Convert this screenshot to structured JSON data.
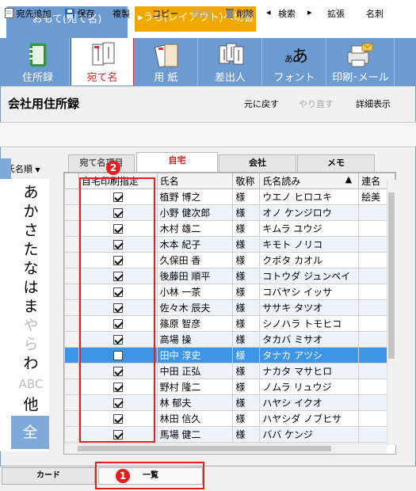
{
  "top_tabs": {
    "front": "おもて(宛て名)",
    "back": "▸うら(レイアウト)へ切替"
  },
  "ribbon": [
    {
      "label": "住所録",
      "icon": "address-book-icon",
      "active": false
    },
    {
      "label": "宛て名",
      "icon": "addressee-icon",
      "active": true
    },
    {
      "label": "用 紙",
      "icon": "paper-icon",
      "active": false
    },
    {
      "label": "差出人",
      "icon": "sender-icon",
      "active": false
    },
    {
      "label": "フォント",
      "icon": "font-icon",
      "active": false
    },
    {
      "label": "印刷･メール",
      "icon": "printer-mail-icon",
      "active": false
    }
  ],
  "window": {
    "title": "会社用住所録",
    "undo": "元に戻す",
    "redo": "やり直す",
    "detail": "詳細表示"
  },
  "toolbar": {
    "add": "宛先追加",
    "save": "保存",
    "duplicate": "複製",
    "copy": "コピー",
    "paste": "貼付",
    "delete": "削除",
    "search": "検索",
    "expand": "拡張",
    "card": "名刺"
  },
  "sort_label": "氏名順",
  "index": [
    "あ",
    "か",
    "さ",
    "た",
    "な",
    "は",
    "ま",
    "や",
    "ら",
    "わ",
    "ABC",
    "他",
    "全"
  ],
  "inner_tabs": {
    "addr_name": "宛て名項目",
    "home": "自宅",
    "company": "会社",
    "memo": "メモ"
  },
  "grid": {
    "headers": [
      "自宅印刷指定",
      "氏名",
      "敬称",
      "氏名読み",
      "連名"
    ],
    "sort_indicator": "▲",
    "rows": [
      {
        "checked": true,
        "name": "植野 博之",
        "honorific": "様",
        "reading": "ウエノ ヒロユキ",
        "joint": "絵美"
      },
      {
        "checked": true,
        "name": "小野 健次郎",
        "honorific": "様",
        "reading": "オノ ケンジロウ",
        "joint": ""
      },
      {
        "checked": true,
        "name": "木村 雄二",
        "honorific": "様",
        "reading": "キムラ ユウジ",
        "joint": ""
      },
      {
        "checked": true,
        "name": "木本 紀子",
        "honorific": "様",
        "reading": "キモト ノリコ",
        "joint": ""
      },
      {
        "checked": true,
        "name": "久保田 香",
        "honorific": "様",
        "reading": "クボタ カオル",
        "joint": ""
      },
      {
        "checked": true,
        "name": "後藤田 順平",
        "honorific": "様",
        "reading": "コトウダ ジュンペイ",
        "joint": ""
      },
      {
        "checked": true,
        "name": "小林 一茶",
        "honorific": "様",
        "reading": "コバヤシ イッサ",
        "joint": ""
      },
      {
        "checked": true,
        "name": "佐々木 辰夫",
        "honorific": "様",
        "reading": "ササキ タツオ",
        "joint": ""
      },
      {
        "checked": true,
        "name": "篠原 智彦",
        "honorific": "様",
        "reading": "シノハラ トモヒコ",
        "joint": ""
      },
      {
        "checked": true,
        "name": "高場 操",
        "honorific": "様",
        "reading": "タカバ ミサオ",
        "joint": ""
      },
      {
        "checked": false,
        "name": "田中 淳史",
        "honorific": "様",
        "reading": "タナカ アツシ",
        "joint": "",
        "selected": true
      },
      {
        "checked": true,
        "name": "中田 正弘",
        "honorific": "様",
        "reading": "ナカタ マサヒロ",
        "joint": ""
      },
      {
        "checked": true,
        "name": "野村 隆二",
        "honorific": "様",
        "reading": "ノムラ リュウジ",
        "joint": ""
      },
      {
        "checked": true,
        "name": "林 郁夫",
        "honorific": "様",
        "reading": "ハヤシ イクオ",
        "joint": ""
      },
      {
        "checked": true,
        "name": "林田 信久",
        "honorific": "様",
        "reading": "ハヤシダ ノブヒサ",
        "joint": ""
      },
      {
        "checked": true,
        "name": "馬場 健二",
        "honorific": "様",
        "reading": "ババ ケンジ",
        "joint": ""
      }
    ]
  },
  "annotations": {
    "badge1": "1",
    "badge2": "2"
  },
  "bottom_tabs": {
    "card": "カード",
    "list": "一覧"
  },
  "colors": {
    "ribbon": "#6c9bd2",
    "accent_orange": "#f0a800",
    "selection": "#3d95e8",
    "annotation": "#e0201c"
  }
}
